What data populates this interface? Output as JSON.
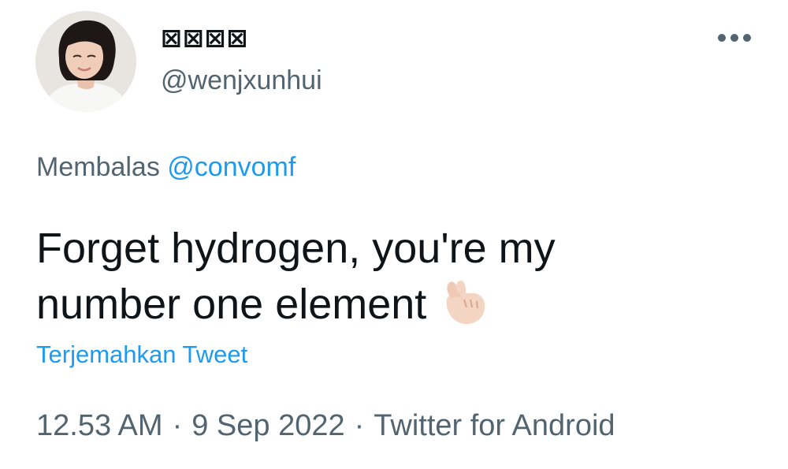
{
  "author": {
    "display_name": "⊠⊠⊠⊠",
    "handle": "@wenjxunhui",
    "avatar_icon": "profile-photo"
  },
  "more_icon": "more-horizontal-icon",
  "reply": {
    "prefix": "Membalas",
    "mention": "@convomf"
  },
  "tweet": {
    "line1": "Forget hydrogen, you're my",
    "line2": "number one element",
    "emoji_icon": "finger-heart-emoji"
  },
  "translate_label": "Terjemahkan Tweet",
  "meta": {
    "time": "12.53 AM",
    "date": "9 Sep 2022",
    "source": "Twitter for Android",
    "separator": "·"
  },
  "colors": {
    "text": "#0f1419",
    "secondary": "#536471",
    "link": "#1d9bf0"
  }
}
